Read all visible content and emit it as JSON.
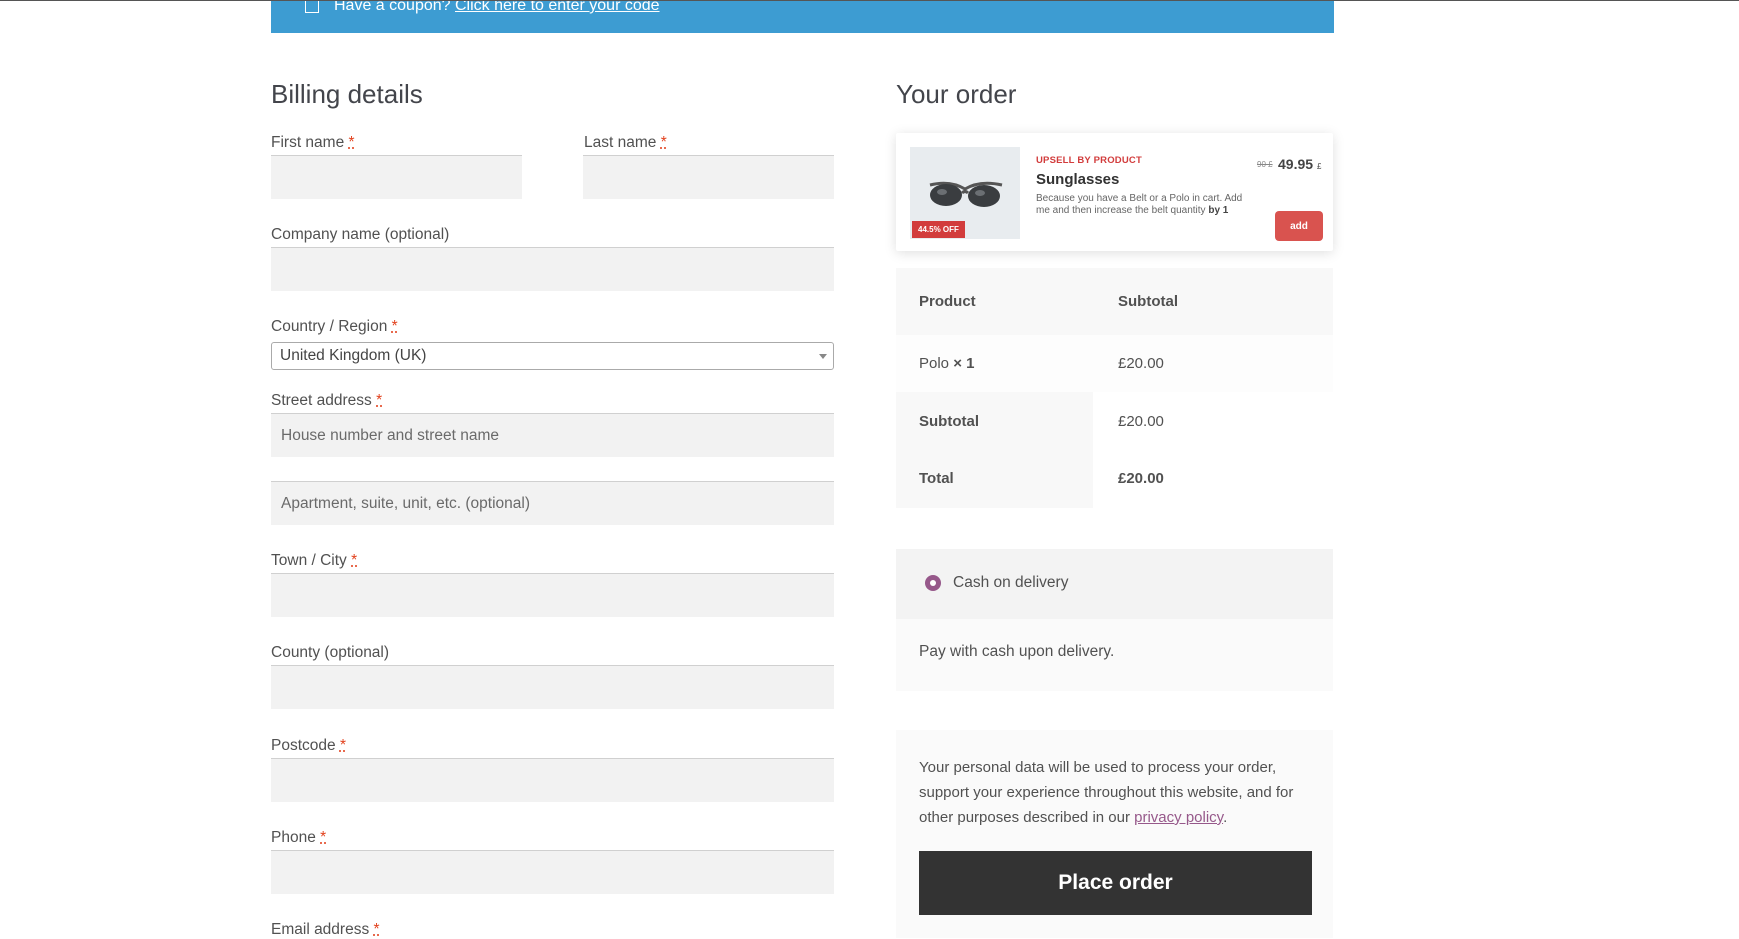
{
  "coupon": {
    "text": "Have a coupon?",
    "link": "Click here to enter your code"
  },
  "billing": {
    "title": "Billing details",
    "first_name_label": "First name",
    "last_name_label": "Last name",
    "company_label": "Company name (optional)",
    "country_label": "Country / Region",
    "country_value": "United Kingdom (UK)",
    "street_label": "Street address",
    "street_placeholder": "House number and street name",
    "apartment_placeholder": "Apartment, suite, unit, etc. (optional)",
    "city_label": "Town / City",
    "county_label": "County (optional)",
    "postcode_label": "Postcode",
    "phone_label": "Phone",
    "email_label": "Email address",
    "required_mark": "*"
  },
  "order": {
    "title": "Your order",
    "upsell": {
      "tag": "UPSELL BY PRODUCT",
      "name": "Sunglasses",
      "description_prefix": "Because you have a Belt or a Polo in cart. Add me and then increase the belt quantity ",
      "description_bold": "by 1",
      "old_price": "90 £",
      "new_price": "49.95",
      "currency": "£",
      "discount_badge": "44.5% OFF",
      "add_label": "add"
    },
    "table": {
      "col_product": "Product",
      "col_subtotal": "Subtotal",
      "item_name": "Polo",
      "item_qty": "× 1",
      "item_price": "£20.00",
      "subtotal_label": "Subtotal",
      "subtotal_value": "£20.00",
      "total_label": "Total",
      "total_value": "£20.00"
    },
    "payment": {
      "method_label": "Cash on delivery",
      "description": "Pay with cash upon delivery."
    },
    "terms": {
      "text": "Your personal data will be used to process your order, support your experience throughout this website, and for other purposes described in our ",
      "link": "privacy policy",
      "end": "."
    },
    "place_order_label": "Place order"
  },
  "colors": {
    "coupon_bar": "#3d9cd2",
    "required": "#e2401c",
    "accent": "#96588a",
    "upsell_red": "#d23c3c",
    "place_order_bg": "#333333"
  }
}
